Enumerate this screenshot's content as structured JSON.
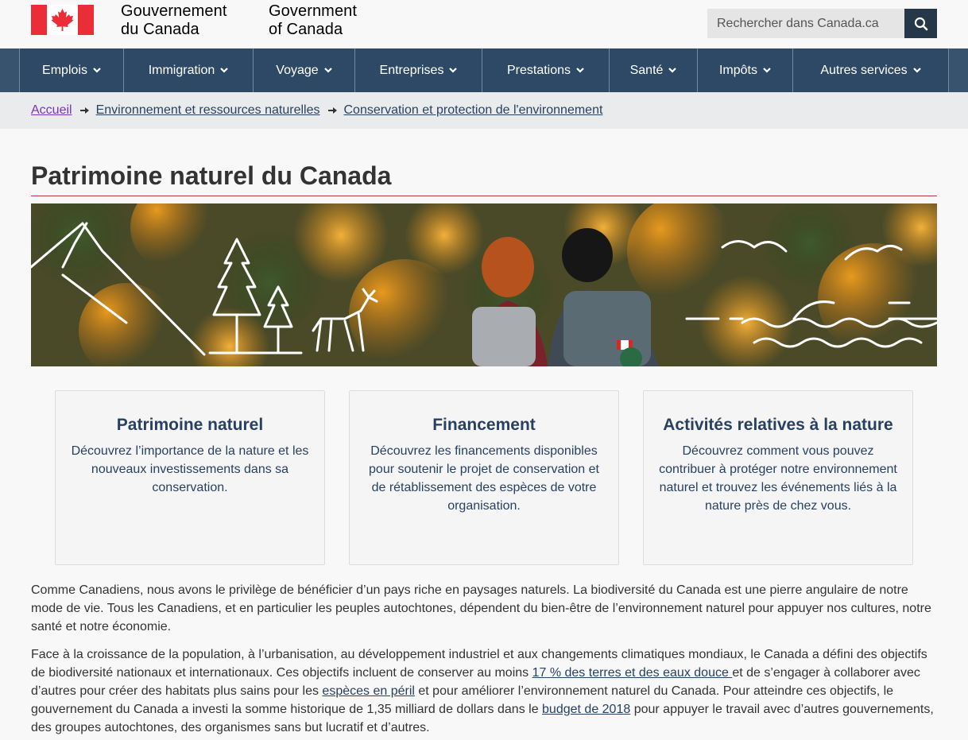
{
  "header": {
    "signature_fr": [
      "Gouvernement",
      "du Canada"
    ],
    "signature_en": [
      "Government",
      "of Canada"
    ],
    "search_placeholder": "Rechercher dans Canada.ca",
    "colors": {
      "flag_red": "#eb2d37",
      "nav": "#2e4965",
      "search_button": "#26374a"
    }
  },
  "menu": {
    "items": [
      "Emplois",
      "Immigration",
      "Voyage",
      "Entreprises",
      "Prestations",
      "Santé",
      "Impôts",
      "Autres services"
    ]
  },
  "breadcrumb": {
    "items": [
      "Accueil",
      "Environnement et ressources naturelles",
      "Conservation et protection de l'environnement"
    ]
  },
  "page": {
    "title": "Patrimoine naturel du Canada",
    "banner_alt_icons": [
      "mountain-icon",
      "pine-tree-icon",
      "deer-icon",
      "bird-icon",
      "water-wave-icon",
      "fish-icon"
    ]
  },
  "cards": [
    {
      "title": "Patrimoine naturel",
      "desc": "Découvrez l’importance de la nature et les nouveaux investissements dans sa conservation."
    },
    {
      "title": "Financement",
      "desc": "Découvrez les financements disponibles pour soutenir le projet de conservation et de rétablissement des espèces de votre organisation."
    },
    {
      "title": "Activités relatives à la nature",
      "desc": "Découvrez comment vous pouvez contribuer à protéger notre environnement naturel et trouvez les événements liés à la nature près de chez vous."
    }
  ],
  "body": {
    "p1": "Comme Canadiens, nous avons le privilège de bénéficier d’un pays riche en paysages naturels. La biodiversité du Canada est une pierre angulaire de notre mode de vie. Tous les Canadiens, et en particulier les peuples autochtones, dépendent du bien-être de l’environnement naturel pour appuyer nos cultures, notre santé et notre économie.",
    "p2_a": "Face à la croissance de la population, à l’urbanisation, au développement industriel et aux changements climatiques mondiaux, le Canada a défini des objectifs de biodiversité nationaux et internationaux. Ces objectifs incluent de conserver au moins ",
    "p2_link1": "17 % des terres et des eaux douce ",
    "p2_b": "et de s’engager à collaborer avec d’autres pour créer des habitats plus sains pour les ",
    "p2_link2": "espèces en péril",
    "p2_c": " et pour améliorer l’environnement naturel du Canada. Pour atteindre ces objectifs, le gouvernement du Canada a investi la somme historique de 1,35 milliard de dollars dans le ",
    "p2_link3": "budget de 2018",
    "p2_d": " pour appuyer le travail avec d’autres gouvernements, des groupes autochtones, des organismes sans but lucratif et d’autres."
  }
}
